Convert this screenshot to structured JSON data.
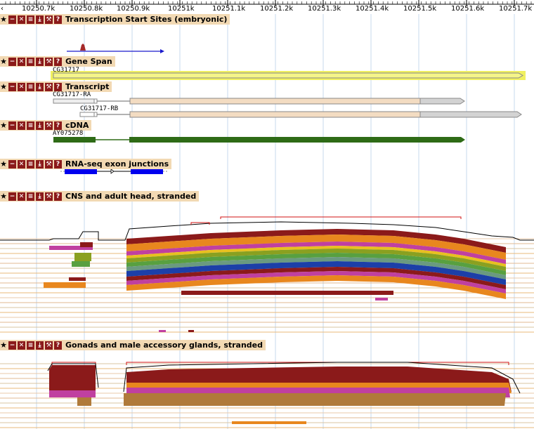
{
  "ruler": {
    "left_arrow": "‹",
    "ticks": [
      "10250.7k",
      "10250.8k",
      "10250.9k",
      "10251k",
      "10251.1k",
      "10251.2k",
      "10251.3k",
      "10251.4k",
      "10251.5k",
      "10251.6k",
      "10251.7k"
    ]
  },
  "track_buttons": {
    "favorite": "favorite-star",
    "minimize": "minimize-icon",
    "close": "close-icon",
    "feed": "rss-icon",
    "download": "download-icon",
    "configure": "wrench-icon",
    "help": "help-icon",
    "star_glyph": "★",
    "minus_glyph": "−",
    "x_glyph": "✕",
    "feed_glyph": "≡",
    "dl_glyph": "⤓",
    "wrench_glyph": "⚒",
    "help_glyph": "?"
  },
  "tracks": [
    {
      "id": "tss",
      "title": "Transcription Start Sites (embryonic)"
    },
    {
      "id": "gene",
      "title": "Gene Span",
      "feature": "CG31717"
    },
    {
      "id": "transcript",
      "title": "Transcript",
      "features": [
        "CG31717-RA",
        "CG31717-RB"
      ]
    },
    {
      "id": "cdna",
      "title": "cDNA",
      "feature": "AY075278"
    },
    {
      "id": "rnaseq",
      "title": "RNA-seq exon junctions"
    },
    {
      "id": "cns",
      "title": "CNS and adult head, stranded"
    },
    {
      "id": "gonads",
      "title": "Gonads and male accessory glands, stranded"
    }
  ],
  "colors": {
    "header_bg": "#f2d9b3",
    "button_bg": "#8b1a1a",
    "gene_fill": "#f5f58a",
    "gene_border": "#aaaaaa",
    "transcript_fill": "#f3dcc2",
    "transcript_utr": "#d3d3d3",
    "cdna": "#2e6b16",
    "junction": "#0000ee",
    "tss_bar": "#a52a2a",
    "coverage_line": "#000000",
    "peak_line": "#d01010",
    "dark_red": "#8b1a1a",
    "orange": "#e8871e",
    "magenta": "#c040a0",
    "olive": "#8aa020",
    "green": "#58a040",
    "blue": "#1c3fa8",
    "teal": "#6a9a80",
    "tan": "#b07a3a",
    "yellow": "#e8c020"
  }
}
